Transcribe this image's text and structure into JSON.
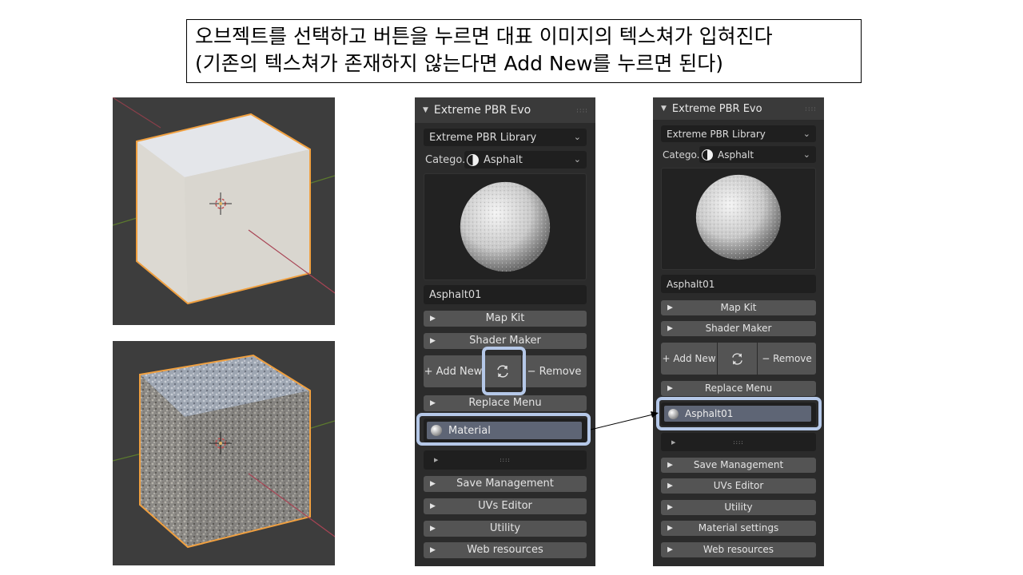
{
  "caption": {
    "line1": "오브젝트를 선택하고 버튼을 누르면 대표 이미지의 텍스쳐가 입혀진다",
    "line2": "(기존의 텍스쳐가 존재하지 않는다면 Add New를 누르면 된다)"
  },
  "panel_left": {
    "header_title": "Extreme PBR Evo",
    "grip": "::::",
    "library_select": "Extreme PBR Library",
    "category_label": "Catego...",
    "category_value": "Asphalt",
    "material_name": "Asphalt01",
    "map_kit": "Map Kit",
    "shader_maker": "Shader Maker",
    "add_new": "+ Add New",
    "refresh_icon": "refresh-icon",
    "remove": "− Remove",
    "replace_menu": "Replace Menu",
    "slot_material": "Material",
    "sub_grip": "::::",
    "save_management": "Save Management",
    "uvs_editor": "UVs Editor",
    "utility": "Utility",
    "web_resources": "Web resources"
  },
  "panel_right": {
    "header_title": "Extreme PBR Evo",
    "grip": "::::",
    "library_select": "Extreme PBR Library",
    "category_label": "Catego...",
    "category_value": "Asphalt",
    "material_name": "Asphalt01",
    "map_kit": "Map Kit",
    "shader_maker": "Shader Maker",
    "add_new": "+ Add New",
    "refresh_icon": "refresh-icon",
    "remove": "− Remove",
    "replace_menu": "Replace Menu",
    "slot_material": "Asphalt01",
    "sub_grip": "::::",
    "save_management": "Save Management",
    "uvs_editor": "UVs Editor",
    "utility": "Utility",
    "material_settings": "Material settings",
    "web_resources": "Web resources"
  },
  "colors": {
    "highlight": "#b5c8e8",
    "cube_outline": "#f0a040",
    "panel_bg": "#2b2b2b",
    "button_bg": "#545454"
  }
}
